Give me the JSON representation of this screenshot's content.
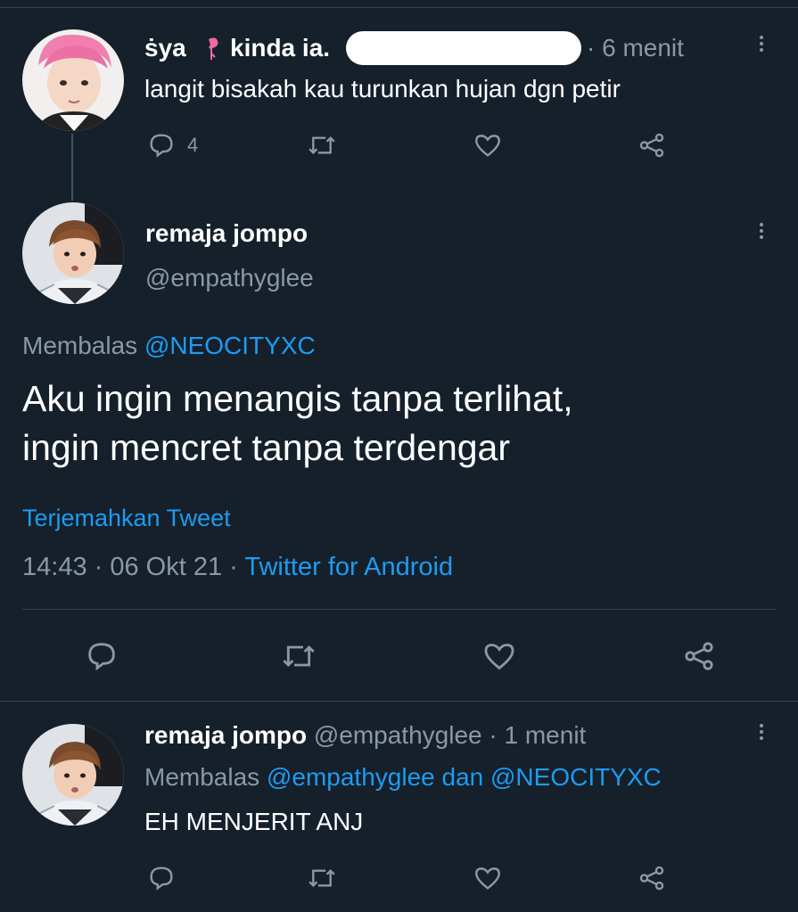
{
  "tweet1": {
    "display_name_a": "ṡya",
    "display_name_b": "kinda ia.",
    "time": "· 6 menit",
    "text": "langit bisakah kau turunkan hujan dgn petir",
    "reply_count": "4"
  },
  "tweet2": {
    "display_name": "remaja jompo",
    "handle": "@empathyglee",
    "reply_label": "Membalas",
    "reply_to": "@NEOCITYXC",
    "text_line1": "Aku ingin menangis tanpa terlihat,",
    "text_line2": "ingin mencret tanpa terdengar",
    "translate": "Terjemahkan Tweet",
    "timestamp": "14:43 · 06 Okt 21 ·",
    "source": "Twitter for Android"
  },
  "tweet3": {
    "display_name": "remaja jompo",
    "handle": "@empathyglee",
    "time": "· 1 menit",
    "reply_label": "Membalas",
    "reply_to_a": "@empathyglee",
    "reply_and": "dan",
    "reply_to_b": "@NEOCITYXC",
    "text": "EH MENJERIT ANJ"
  },
  "colors": {
    "background": "#15202b",
    "text": "#ffffff",
    "muted": "#8b98a5",
    "link": "#1d9bf0",
    "divider": "#38444d"
  }
}
